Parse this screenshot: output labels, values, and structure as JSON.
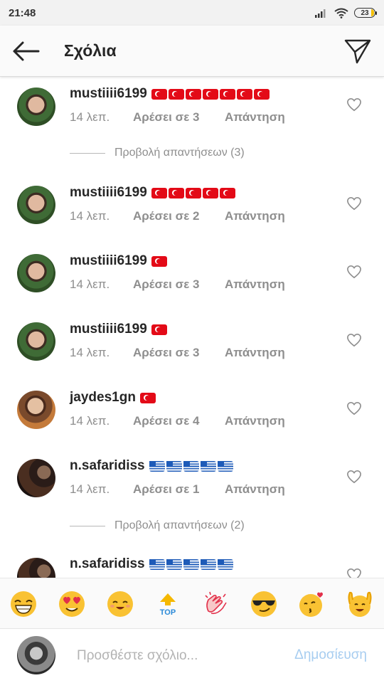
{
  "status_bar": {
    "time": "21:48",
    "battery_level": "23"
  },
  "header": {
    "title": "Σχόλια"
  },
  "comments": [
    {
      "username": "mustiiii6199",
      "flag": "turkey",
      "flag_count": 7,
      "time": "14 λεπ.",
      "likes": "Αρέσει σε 3",
      "reply": "Απάντηση"
    },
    {
      "username": "mustiiii6199",
      "flag": "turkey",
      "flag_count": 5,
      "time": "14 λεπ.",
      "likes": "Αρέσει σε 2",
      "reply": "Απάντηση"
    },
    {
      "username": "mustiiii6199",
      "flag": "turkey",
      "flag_count": 1,
      "time": "14 λεπ.",
      "likes": "Αρέσει σε 3",
      "reply": "Απάντηση"
    },
    {
      "username": "mustiiii6199",
      "flag": "turkey",
      "flag_count": 1,
      "time": "14 λεπ.",
      "likes": "Αρέσει σε 3",
      "reply": "Απάντηση"
    },
    {
      "username": "jaydes1gn",
      "flag": "turkey",
      "flag_count": 1,
      "time": "14 λεπ.",
      "likes": "Αρέσει σε 4",
      "reply": "Απάντηση"
    },
    {
      "username": "n.safaridiss",
      "flag": "greece",
      "flag_count": 5,
      "time": "14 λεπ.",
      "likes": "Αρέσει σε 1",
      "reply": "Απάντηση"
    },
    {
      "username": "n.safaridiss",
      "flag": "greece",
      "flag_count": 5
    }
  ],
  "view_replies": [
    {
      "label": "Προβολή απαντήσεων (3)"
    },
    {
      "label": "Προβολή απαντήσεων (2)"
    }
  ],
  "emoji_bar": {
    "items": [
      "grinning-face",
      "heart-eyes-face",
      "smiling-face",
      "top-arrow",
      "clapping-hands",
      "sunglasses-face",
      "kissing-face",
      "raised-hands-face"
    ],
    "top_label": "TOP"
  },
  "composer": {
    "placeholder": "Προσθέστε σχόλιο...",
    "post_label": "Δημοσίευση"
  },
  "colors": {
    "accent_disabled": "#a7cdf0",
    "secondary_text": "#8e8e8e",
    "turkey_red": "#e30a17",
    "greece_blue": "#1e5bb8"
  }
}
